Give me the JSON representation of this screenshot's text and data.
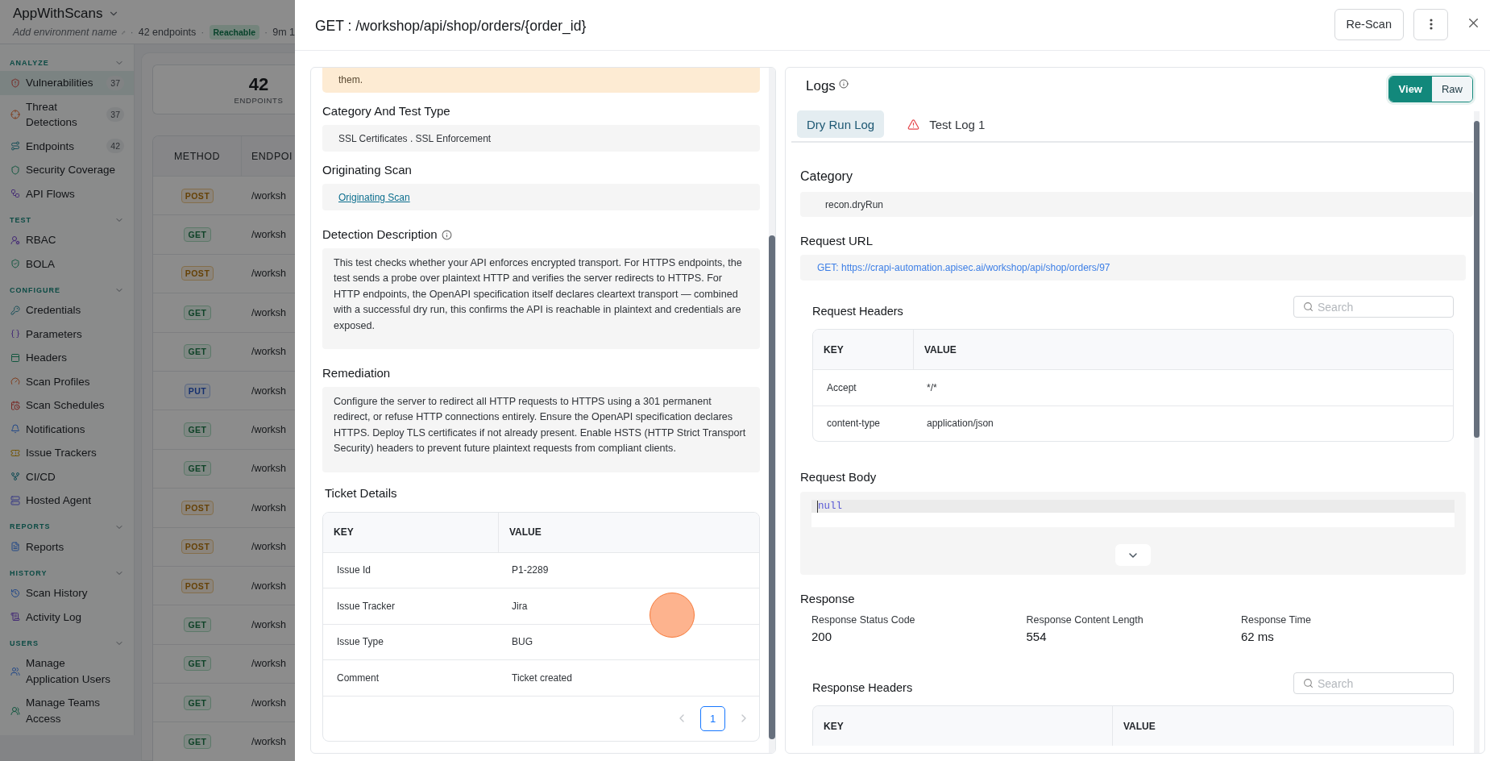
{
  "app_header": {
    "title": "AppWithScans",
    "meta": [
      {
        "kind": "placeholder",
        "text": "Add environment name"
      },
      {
        "kind": "separator",
        "text": "·"
      },
      {
        "kind": "text",
        "text": "42 endpoints"
      },
      {
        "kind": "separator",
        "text": "·"
      },
      {
        "kind": "badge",
        "text": "Reachable"
      },
      {
        "kind": "separator",
        "text": "·"
      },
      {
        "kind": "text",
        "text": "9m 1"
      }
    ]
  },
  "sidebar": {
    "sections": [
      {
        "label": "ANALYZE",
        "expanded": true,
        "items": [
          {
            "label": "Vulnerabilities",
            "count": "37",
            "selected": true
          },
          {
            "label": "Threat Detections",
            "count": "37",
            "selected": false
          },
          {
            "label": "Endpoints",
            "count": "42",
            "selected": false
          },
          {
            "label": "Security Coverage",
            "selected": false
          },
          {
            "label": "API Flows",
            "selected": false
          }
        ]
      },
      {
        "label": "TEST",
        "expanded": true,
        "items": [
          {
            "label": "RBAC",
            "selected": false
          },
          {
            "label": "BOLA",
            "selected": false
          }
        ]
      },
      {
        "label": "CONFIGURE",
        "expanded": true,
        "items": [
          {
            "label": "Credentials",
            "selected": false
          },
          {
            "label": "Parameters",
            "selected": false
          },
          {
            "label": "Headers",
            "selected": false
          },
          {
            "label": "Scan Profiles",
            "selected": false
          },
          {
            "label": "Scan Schedules",
            "selected": false
          },
          {
            "label": "Notifications",
            "selected": false
          },
          {
            "label": "Issue Trackers",
            "selected": false
          },
          {
            "label": "CI/CD",
            "selected": false
          },
          {
            "label": "Hosted Agent",
            "selected": false
          }
        ]
      },
      {
        "label": "REPORTS",
        "expanded": true,
        "items": [
          {
            "label": "Reports",
            "selected": false
          }
        ]
      },
      {
        "label": "HISTORY",
        "expanded": true,
        "items": [
          {
            "label": "Scan History",
            "selected": false
          },
          {
            "label": "Activity Log",
            "selected": false
          }
        ]
      },
      {
        "label": "USERS",
        "expanded": true,
        "items": [
          {
            "label": "Manage Application Users",
            "selected": false
          },
          {
            "label": "Manage Teams Access",
            "selected": false
          }
        ]
      }
    ]
  },
  "summary": {
    "value": "42",
    "label": "ENDPOINTS"
  },
  "endpoints_table": {
    "columns": [
      "METHOD",
      "ENDPOI"
    ],
    "rows": [
      {
        "method": "POST",
        "kind": "post",
        "endpoint": "/worksh"
      },
      {
        "method": "GET",
        "kind": "get",
        "endpoint": "/worksh"
      },
      {
        "method": "POST",
        "kind": "post",
        "endpoint": "/worksh"
      },
      {
        "method": "GET",
        "kind": "get",
        "endpoint": "/worksh"
      },
      {
        "method": "GET",
        "kind": "get",
        "endpoint": "/worksh"
      },
      {
        "method": "PUT",
        "kind": "put",
        "endpoint": "/worksh"
      },
      {
        "method": "GET",
        "kind": "get",
        "endpoint": "/worksh"
      },
      {
        "method": "GET",
        "kind": "get",
        "endpoint": "/worksh"
      },
      {
        "method": "POST",
        "kind": "post",
        "endpoint": "/worksh"
      },
      {
        "method": "POST",
        "kind": "post",
        "endpoint": "/worksh"
      },
      {
        "method": "POST",
        "kind": "post",
        "endpoint": "/worksh"
      },
      {
        "method": "GET",
        "kind": "get",
        "endpoint": "/worksh"
      },
      {
        "method": "GET",
        "kind": "get",
        "endpoint": "/worksh"
      },
      {
        "method": "GET",
        "kind": "get",
        "endpoint": "/worksh"
      },
      {
        "method": "GET",
        "kind": "get",
        "endpoint": "/worksh"
      }
    ]
  },
  "drawer": {
    "title": "GET : /workshop/api/shop/orders/{order_id}",
    "rescan_button": "Re-Scan"
  },
  "details": {
    "warning": {
      "text": "them."
    },
    "sections": [
      {
        "heading": "Category And Test Type",
        "kind": "text",
        "info": false,
        "value": "SSL Certificates . SSL Enforcement"
      },
      {
        "heading": "Originating Scan",
        "kind": "link",
        "info": false,
        "value": "Originating Scan"
      },
      {
        "heading": "Detection Description",
        "kind": "paragraph",
        "info": true,
        "value": "This test checks whether your API enforces encrypted transport. For HTTPS endpoints, the test sends a probe over plaintext HTTP and verifies the server redirects to HTTPS. For HTTP endpoints, the OpenAPI specification itself declares cleartext transport — combined with a successful dry run, this confirms the API is reachable in plaintext and credentials are exposed."
      },
      {
        "heading": "Remediation",
        "kind": "paragraph",
        "info": false,
        "value": "Configure the server to redirect all HTTP requests to HTTPS using a 301 permanent redirect, or refuse HTTP connections entirely. Ensure the OpenAPI specification declares HTTPS. Deploy TLS certificates if not already present. Enable HSTS (HTTP Strict Transport Security) headers to prevent future plaintext requests from compliant clients."
      }
    ],
    "ticket": {
      "heading": "Ticket Details",
      "columns": [
        "KEY",
        "VALUE"
      ],
      "rows": [
        {
          "key": "Issue Id",
          "value": "P1-2289"
        },
        {
          "key": "Issue Tracker",
          "value": "Jira"
        },
        {
          "key": "Issue Type",
          "value": "BUG"
        },
        {
          "key": "Comment",
          "value": "Ticket created"
        }
      ],
      "pagination": {
        "prev_disabled": true,
        "next_disabled": true,
        "pages": [
          {
            "label": "1",
            "selected": true
          }
        ]
      }
    }
  },
  "logs": {
    "title": "Logs",
    "info": true,
    "view_modes": [
      {
        "label": "View",
        "selected": true
      },
      {
        "label": "Raw",
        "selected": false
      }
    ],
    "tabs": [
      {
        "label": "Dry Run Log",
        "selected": true,
        "warning": false
      },
      {
        "label": "Test Log 1",
        "selected": false,
        "warning": true
      }
    ],
    "category": {
      "heading": "Category",
      "value": "recon.dryRun"
    },
    "request_url": {
      "heading": "Request URL",
      "value": "GET: https://crapi-automation.apisec.ai/workshop/api/shop/orders/97"
    },
    "request_headers": {
      "heading": "Request Headers",
      "placeholder": "Search",
      "columns": [
        "KEY",
        "VALUE"
      ],
      "rows": [
        {
          "key": "Accept",
          "value": "*/*"
        },
        {
          "key": "content-type",
          "value": "application/json"
        }
      ]
    },
    "request_body": {
      "heading": "Request Body",
      "code": "null"
    },
    "response": {
      "heading": "Response",
      "metrics": [
        {
          "label": "Response Status Code",
          "value": "200"
        },
        {
          "label": "Response Content Length",
          "value": "554"
        },
        {
          "label": "Response Time",
          "value": "62 ms"
        }
      ]
    },
    "response_headers": {
      "heading": "Response Headers",
      "placeholder": "Search",
      "columns": [
        "KEY",
        "VALUE"
      ]
    }
  }
}
